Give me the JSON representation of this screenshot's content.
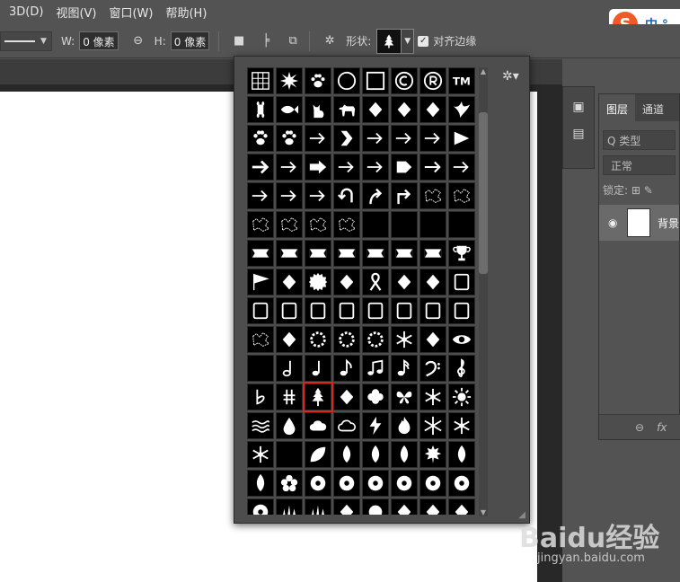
{
  "menu": [
    "3D(D)",
    "视图(V)",
    "窗口(W)",
    "帮助(H)"
  ],
  "options_bar": {
    "w_label": "W:",
    "w_value": "0 像素",
    "h_label": "H:",
    "h_value": "0 像素",
    "shape_label": "形状:",
    "align_label": "对齐边缘",
    "align_checked": true
  },
  "ime": {
    "logo": "S",
    "text": "中 °,"
  },
  "shape_picker": {
    "columns": 8,
    "selected_shape": "tree",
    "shapes": [
      "grid",
      "starburst",
      "paw-print",
      "circle",
      "square",
      "copyright",
      "registered",
      "trademark",
      "bone",
      "fish",
      "cat",
      "dog",
      "snail",
      "rabbit",
      "bird-parrot",
      "dove",
      "paw-1",
      "paw-2",
      "arrow-ornate",
      "arrow-chevron",
      "arrow-thin",
      "arrow-feather",
      "arrow-line",
      "arrow-triangle",
      "arrow-bold",
      "arrow-feathered",
      "arrow-block",
      "arrow-sharp",
      "arrow-notched",
      "arrow-pentagon",
      "arrow-plain",
      "arrow-wavy",
      "arrow-dart",
      "arrow-double",
      "arrow-squiggle",
      "arrow-u-turn",
      "arrow-curve-up",
      "arrow-corner",
      "grass-texture",
      "grunge-splat",
      "grunge-1",
      "grunge-2",
      "dots-texture",
      "swirl-texture",
      "crescent-1",
      "crescent-2",
      "crescent-3",
      "",
      "banner-1",
      "banner-2",
      "banner-3",
      "banner-4",
      "banner-5",
      "scroll-flag",
      "scroll-banner",
      "trophy",
      "flag",
      "wavy-flag",
      "seal",
      "medal-ribbon",
      "ribbon",
      "film-frame",
      "ticket",
      "frame-rect",
      "frame-oval",
      "frame-ornate",
      "frame-round",
      "frame-1",
      "frame-stamp",
      "frame-square",
      "frame-2",
      "frame-grunge",
      "grunge-bar",
      "bar-line",
      "wreath-1",
      "wreath-2",
      "wreath-3",
      "sunburst",
      "lightbulb",
      "eye",
      "",
      "note-half",
      "note-quarter",
      "note-eighth",
      "note-beamed",
      "note-sixteenth",
      "bass-clef",
      "treble-clef",
      "flat",
      "sharp",
      "tree",
      "fern",
      "clover",
      "butterfly",
      "sun-swirl",
      "sun",
      "waves",
      "raindrop",
      "cloud",
      "cloud-outline",
      "lightning",
      "fire",
      "snowflake-1",
      "snowflake-2",
      "snowflake-3",
      "crescent-moon",
      "leaf-1",
      "leaf-maple",
      "leaf-2",
      "leaf-3",
      "maple",
      "tree-leaf",
      "leaf-4",
      "flower-1",
      "flower-branch",
      "flower-stem",
      "flower-2",
      "flower-3",
      "flower-4",
      "flower-5",
      "flower-6",
      "grass-1",
      "grass-2",
      "tulip",
      "dot",
      "skull",
      "flame-hand",
      "hand",
      "footprint"
    ]
  },
  "layers_panel": {
    "tabs": [
      "图层",
      "通道"
    ],
    "search_placeholder": "Q 类型",
    "blend_mode": "正常",
    "lock_label": "锁定:",
    "layer_name": "背景",
    "footer_icons": [
      "link-icon",
      "fx-icon"
    ]
  },
  "watermark": {
    "brand": "Baidu经验",
    "url": "jingyan.baidu.com"
  }
}
